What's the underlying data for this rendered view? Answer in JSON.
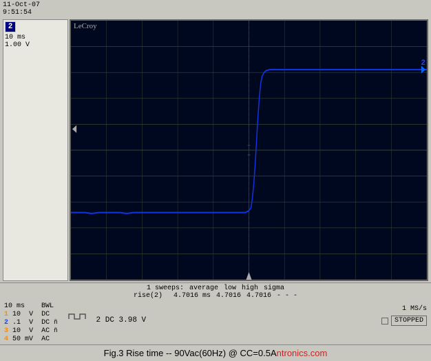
{
  "timestamp": {
    "date": "11-Oct-07",
    "time": "9:51:54"
  },
  "left_panel": {
    "channel": "2",
    "timebase": "10 ms",
    "voltage": "1.00 V"
  },
  "lecroy_label": "LeCroy",
  "stats": {
    "sweeps": "1 sweeps:",
    "label_average": "average",
    "label_low": "low",
    "label_high": "high",
    "label_sigma": "sigma",
    "param": "rise(2)",
    "average_val": "4.7016 ms",
    "low_val": "4.7016",
    "high_val": "4.7016",
    "sigma_val": "- - -"
  },
  "bottom_controls": {
    "timebase": "10 ms",
    "bwl": "BWL",
    "ch1_num": "1",
    "ch1_volt": "10",
    "ch1_unit": "V",
    "ch1_coupling": "DC",
    "ch2_num": "2",
    "ch2_volt": ".1",
    "ch2_unit": "V",
    "ch2_coupling": "DC",
    "ch2_extra": "ñ",
    "ch3_num": "3",
    "ch3_volt": "10",
    "ch3_unit": "V",
    "ch3_coupling": "AC",
    "ch3_extra": "ñ",
    "ch4_num": "4",
    "ch4_volt": "50 mV",
    "ch4_coupling": "AC",
    "ch2_dc_label": "2 DC 3.98 V",
    "sample_rate": "1 MS/s",
    "status": "STOPPED"
  },
  "caption": "Fig.3  Rise time  --  90Vac(60Hz) @  CC=0.5A",
  "caption_brand": "ntronics.com"
}
